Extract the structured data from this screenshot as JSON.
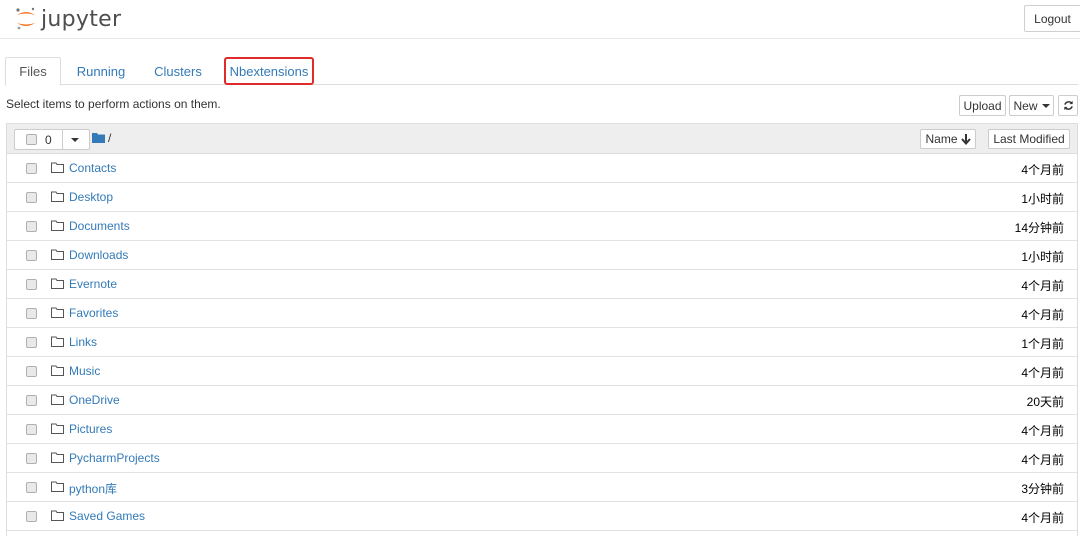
{
  "header": {
    "logo_text": "jupyter",
    "logout_label": "Logout"
  },
  "tabs": [
    {
      "label": "Files",
      "active": true
    },
    {
      "label": "Running",
      "active": false
    },
    {
      "label": "Clusters",
      "active": false
    },
    {
      "label": "Nbextensions",
      "active": false,
      "highlighted": true
    }
  ],
  "toolbar": {
    "instructions": "Select items to perform actions on them.",
    "upload_label": "Upload",
    "new_label": "New",
    "refresh_icon": "refresh-icon"
  },
  "list_header": {
    "selected_count": "0",
    "path": "/",
    "sort_name_label": "Name",
    "sort_modified_label": "Last Modified"
  },
  "files": [
    {
      "name": "Contacts",
      "modified": "4个月前"
    },
    {
      "name": "Desktop",
      "modified": "1小时前"
    },
    {
      "name": "Documents",
      "modified": "14分钟前"
    },
    {
      "name": "Downloads",
      "modified": "1小时前"
    },
    {
      "name": "Evernote",
      "modified": "4个月前"
    },
    {
      "name": "Favorites",
      "modified": "4个月前"
    },
    {
      "name": "Links",
      "modified": "1个月前"
    },
    {
      "name": "Music",
      "modified": "4个月前"
    },
    {
      "name": "OneDrive",
      "modified": "20天前"
    },
    {
      "name": "Pictures",
      "modified": "4个月前"
    },
    {
      "name": "PycharmProjects",
      "modified": "4个月前"
    },
    {
      "name": "python库",
      "modified": "3分钟前"
    },
    {
      "name": "Saved Games",
      "modified": "4个月前"
    }
  ],
  "colors": {
    "link": "#337ab7",
    "highlight_border": "#e02b2b",
    "logo_orange": "#f37726"
  }
}
